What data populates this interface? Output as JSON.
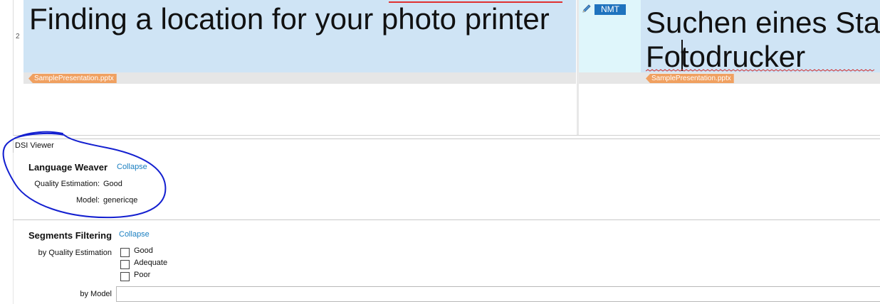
{
  "editor": {
    "row_number": "2",
    "source_text": "Finding a location for your photo printer",
    "source_tag": "SamplePresentation.pptx",
    "status_badge": "NMT",
    "target_line1": "Suchen eines Sta",
    "target_line2": "Fotodrucker",
    "target_tag": "SamplePresentation.pptx"
  },
  "dsi_viewer": {
    "title": "DSI Viewer",
    "language_weaver": {
      "heading": "Language Weaver",
      "collapse_label": "Collapse",
      "quality_label": "Quality Estimation:",
      "quality_value": "Good",
      "model_label": "Model:",
      "model_value": "genericqe"
    },
    "segments_filtering": {
      "heading": "Segments Filtering",
      "collapse_label": "Collapse",
      "by_quality_label": "by Quality Estimation",
      "options": [
        "Good",
        "Adequate",
        "Poor"
      ],
      "by_model_label": "by Model",
      "by_model_value": ""
    }
  },
  "colors": {
    "segment_bg": "#cfe4f5",
    "status_bg": "#dff6fb",
    "nmt_badge": "#1e73be",
    "tag": "#f0a060",
    "link": "#1a7fc1",
    "annotation_circle": "#1420d0"
  },
  "icons": {
    "status": "pencil-icon"
  }
}
